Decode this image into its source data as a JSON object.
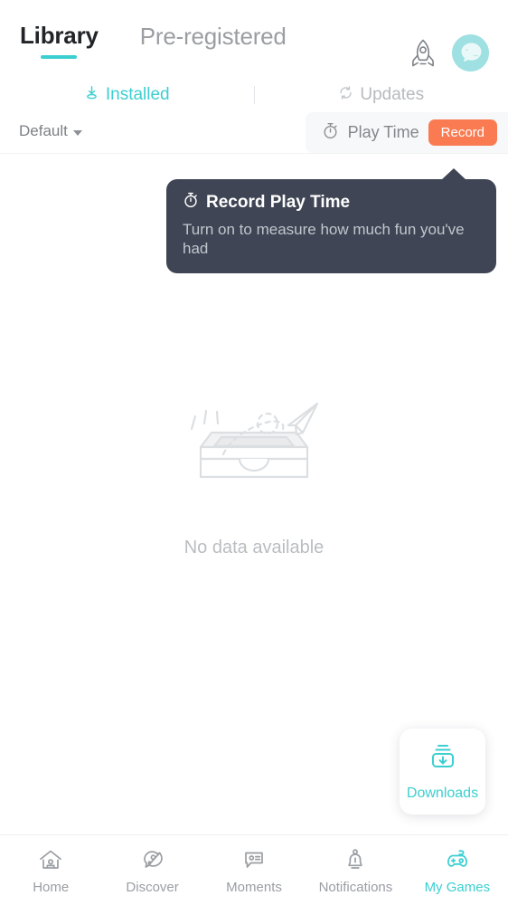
{
  "header": {
    "tabs": [
      {
        "label": "Library",
        "active": true
      },
      {
        "label": "Pre-registered",
        "active": false
      }
    ],
    "rocket_icon": "rocket-icon",
    "avatar_icon": "chat-avatar-icon"
  },
  "subtabs": [
    {
      "label": "Installed",
      "icon": "installed-icon",
      "active": true
    },
    {
      "label": "Updates",
      "icon": "refresh-icon",
      "active": false
    }
  ],
  "filter": {
    "sort_label": "Default",
    "caret_icon": "chevron-down-icon",
    "play_time_label": "Play Time",
    "play_time_icon": "stopwatch-icon",
    "record_label": "Record"
  },
  "tooltip": {
    "icon": "stopwatch-icon",
    "title": "Record Play Time",
    "body": "Turn on to measure how much fun you've had"
  },
  "empty_state": {
    "illustration": "empty-box-paper-plane-icon",
    "message": "No data available"
  },
  "downloads": {
    "icon": "download-box-icon",
    "label": "Downloads"
  },
  "bottom_nav": [
    {
      "label": "Home",
      "icon": "home-icon",
      "active": false
    },
    {
      "label": "Discover",
      "icon": "planet-icon",
      "active": false
    },
    {
      "label": "Moments",
      "icon": "speech-bubble-icon",
      "active": false
    },
    {
      "label": "Notifications",
      "icon": "bell-icon",
      "active": false
    },
    {
      "label": "My Games",
      "icon": "gamepad-icon",
      "active": true
    }
  ],
  "colors": {
    "accent_teal": "#3ccfd1",
    "record_orange": "#fa7b52",
    "tooltip_bg": "#3f4554",
    "muted_gray": "#9a9ea3"
  }
}
